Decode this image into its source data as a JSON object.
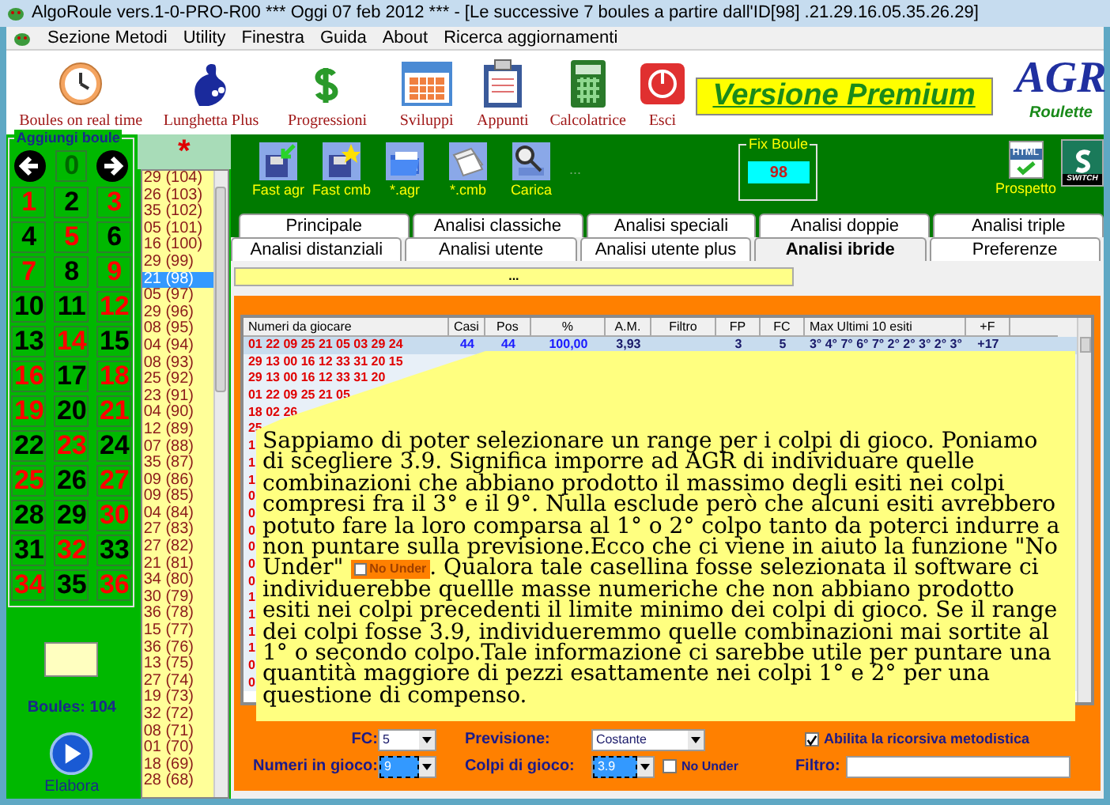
{
  "window": {
    "title": "AlgoRoule vers.1-0-PRO-R00  ***  Oggi 07 feb 2012  ***   - [Le successive 7 boules a partire dall'ID[98] .21.29.16.05.35.26.29]"
  },
  "menu": [
    "Sezione Metodi",
    "Utility",
    "Finestra",
    "Guida",
    "About",
    "Ricerca aggiornamenti"
  ],
  "toolbar": [
    {
      "label": "Boules on real time",
      "kind": "clock"
    },
    {
      "label": "Lunghetta Plus",
      "kind": "lottery"
    },
    {
      "label": "Progressioni",
      "kind": "dollar"
    },
    {
      "label": "Sviluppi",
      "kind": "calendar"
    },
    {
      "label": "Appunti",
      "kind": "clipboard"
    },
    {
      "label": "Calcolatrice",
      "kind": "calculator"
    },
    {
      "label": "Esci",
      "kind": "exit"
    }
  ],
  "banner": "Versione Premium",
  "logo": {
    "letters": "AGR",
    "caption": "Roulette"
  },
  "board": {
    "title": "Aggiungi boule",
    "zero": "0",
    "boules": "Boules: 104",
    "play_label": "Elabora",
    "numbers": [
      {
        "n": "1",
        "color": "#ff0000"
      },
      {
        "n": "2",
        "color": "#000000"
      },
      {
        "n": "3",
        "color": "#ff0000"
      },
      {
        "n": "4",
        "color": "#000000"
      },
      {
        "n": "5",
        "color": "#ff0000"
      },
      {
        "n": "6",
        "color": "#000000"
      },
      {
        "n": "7",
        "color": "#ff0000"
      },
      {
        "n": "8",
        "color": "#000000"
      },
      {
        "n": "9",
        "color": "#ff0000"
      },
      {
        "n": "10",
        "color": "#000000"
      },
      {
        "n": "11",
        "color": "#000000"
      },
      {
        "n": "12",
        "color": "#ff0000"
      },
      {
        "n": "13",
        "color": "#000000"
      },
      {
        "n": "14",
        "color": "#ff0000"
      },
      {
        "n": "15",
        "color": "#000000"
      },
      {
        "n": "16",
        "color": "#ff0000"
      },
      {
        "n": "17",
        "color": "#000000"
      },
      {
        "n": "18",
        "color": "#ff0000"
      },
      {
        "n": "19",
        "color": "#ff0000"
      },
      {
        "n": "20",
        "color": "#000000"
      },
      {
        "n": "21",
        "color": "#ff0000"
      },
      {
        "n": "22",
        "color": "#000000"
      },
      {
        "n": "23",
        "color": "#ff0000"
      },
      {
        "n": "24",
        "color": "#000000"
      },
      {
        "n": "25",
        "color": "#ff0000"
      },
      {
        "n": "26",
        "color": "#000000"
      },
      {
        "n": "27",
        "color": "#ff0000"
      },
      {
        "n": "28",
        "color": "#000000"
      },
      {
        "n": "29",
        "color": "#000000"
      },
      {
        "n": "30",
        "color": "#ff0000"
      },
      {
        "n": "31",
        "color": "#000000"
      },
      {
        "n": "32",
        "color": "#ff0000"
      },
      {
        "n": "33",
        "color": "#000000"
      },
      {
        "n": "34",
        "color": "#ff0000"
      },
      {
        "n": "35",
        "color": "#000000"
      },
      {
        "n": "36",
        "color": "#ff0000"
      }
    ]
  },
  "history": {
    "header": "*",
    "items": [
      {
        "text": "29 (104)",
        "selected": false
      },
      {
        "text": "26 (103)",
        "selected": false
      },
      {
        "text": "35 (102)",
        "selected": false
      },
      {
        "text": "05 (101)",
        "selected": false
      },
      {
        "text": "16 (100)",
        "selected": false
      },
      {
        "text": "29 (99)",
        "selected": false
      },
      {
        "text": "21 (98)",
        "selected": true
      },
      {
        "text": "05 (97)",
        "selected": false
      },
      {
        "text": "29 (96)",
        "selected": false
      },
      {
        "text": "08 (95)",
        "selected": false
      },
      {
        "text": "04 (94)",
        "selected": false
      },
      {
        "text": "08 (93)",
        "selected": false
      },
      {
        "text": "25 (92)",
        "selected": false
      },
      {
        "text": "23 (91)",
        "selected": false
      },
      {
        "text": "04 (90)",
        "selected": false
      },
      {
        "text": "12 (89)",
        "selected": false
      },
      {
        "text": "07 (88)",
        "selected": false
      },
      {
        "text": "35 (87)",
        "selected": false
      },
      {
        "text": "09 (86)",
        "selected": false
      },
      {
        "text": "09 (85)",
        "selected": false
      },
      {
        "text": "04 (84)",
        "selected": false
      },
      {
        "text": "27 (83)",
        "selected": false
      },
      {
        "text": "27 (82)",
        "selected": false
      },
      {
        "text": "21 (81)",
        "selected": false
      },
      {
        "text": "34 (80)",
        "selected": false
      },
      {
        "text": "30 (79)",
        "selected": false
      },
      {
        "text": "36 (78)",
        "selected": false
      },
      {
        "text": "15 (77)",
        "selected": false
      },
      {
        "text": "36 (76)",
        "selected": false
      },
      {
        "text": "13 (75)",
        "selected": false
      },
      {
        "text": "27 (74)",
        "selected": false
      },
      {
        "text": "19 (73)",
        "selected": false
      },
      {
        "text": "32 (72)",
        "selected": false
      },
      {
        "text": "08 (71)",
        "selected": false
      },
      {
        "text": "01 (70)",
        "selected": false
      },
      {
        "text": "18 (69)",
        "selected": false
      },
      {
        "text": "28 (68)",
        "selected": false
      }
    ]
  },
  "actions": [
    {
      "label": "Fast agr",
      "kind": "disk-in"
    },
    {
      "label": "Fast cmb",
      "kind": "disk-star"
    },
    {
      "label": "*.agr",
      "kind": "folder"
    },
    {
      "label": "*.cmb",
      "kind": "pages"
    },
    {
      "label": "Carica",
      "kind": "load"
    }
  ],
  "actions_more": "...",
  "fix_boule": {
    "title": "Fix Boule",
    "value": "98"
  },
  "prospetto": {
    "label": "Prospetto",
    "badge": "HTML"
  },
  "switch_label": "SWITCH",
  "tabs_row1": [
    {
      "label": "Principale",
      "selected": false
    },
    {
      "label": "Analisi classiche",
      "selected": false
    },
    {
      "label": "Analisi speciali",
      "selected": false
    },
    {
      "label": "Analisi doppie",
      "selected": false
    },
    {
      "label": "Analisi triple",
      "selected": false
    }
  ],
  "tabs_row2": [
    {
      "label": "Analisi distanziali",
      "selected": false
    },
    {
      "label": "Analisi utente",
      "selected": false
    },
    {
      "label": "Analisi utente plus",
      "selected": false
    },
    {
      "label": "Analisi ibride",
      "selected": true
    },
    {
      "label": "Preferenze",
      "selected": false
    }
  ],
  "info_bar": "...",
  "table": {
    "columns": [
      "Numeri da giocare",
      "Casi",
      "Pos",
      "%",
      "A.M.",
      "Filtro",
      "FP",
      "FC",
      "Max Ultimi 10 esiti",
      "+F"
    ],
    "rows": [
      {
        "selected": true,
        "cells": [
          "01 22 09 25 21 05 03 29 24",
          "44",
          "44",
          "100,00",
          "3,93",
          "",
          "3",
          "5",
          "3° 4° 7° 6° 7° 2° 2° 3° 2° 3°",
          "+17"
        ]
      },
      {
        "selected": false,
        "cells": [
          "29 13 00 16 12 33 31 20 15"
        ]
      },
      {
        "selected": false,
        "cells": [
          "29 13 00 16 12 33 31 20"
        ]
      },
      {
        "selected": false,
        "cells": [
          "01 22 09 25 21 05"
        ]
      },
      {
        "selected": false,
        "cells": [
          "18 02 26"
        ]
      },
      {
        "selected": false,
        "cells": [
          "25"
        ]
      },
      {
        "selected": false,
        "cells": [
          "1"
        ]
      },
      {
        "selected": false,
        "cells": [
          "1"
        ]
      },
      {
        "selected": false,
        "cells": [
          "1"
        ]
      },
      {
        "selected": false,
        "cells": [
          "0"
        ]
      },
      {
        "selected": false,
        "cells": [
          "0"
        ]
      },
      {
        "selected": false,
        "cells": [
          "0"
        ]
      },
      {
        "selected": false,
        "cells": [
          "0"
        ]
      },
      {
        "selected": false,
        "cells": [
          "0"
        ]
      },
      {
        "selected": false,
        "cells": [
          "0"
        ]
      },
      {
        "selected": false,
        "cells": [
          "1"
        ]
      },
      {
        "selected": false,
        "cells": [
          "1"
        ]
      },
      {
        "selected": false,
        "cells": [
          "1"
        ]
      },
      {
        "selected": false,
        "cells": [
          "1"
        ]
      },
      {
        "selected": false,
        "cells": [
          "0"
        ]
      },
      {
        "selected": false,
        "cells": [
          "0"
        ]
      }
    ]
  },
  "callout": {
    "text_before": "Sappiamo di poter selezionare un range per i colpi di gioco. Poniamo di scegliere 3.9. Significa imporre ad AGR di individuare quelle combinazioni che abbiano prodotto il massimo degli esiti nei colpi compresi fra il 3° e il 9°. Nulla esclude però che alcuni esiti avrebbero potuto fare la loro comparsa al 1° o 2° colpo tanto da poterci indurre a non puntare sulla previsione.Ecco che ci viene in aiuto la funzione \"No Under\"",
    "inline_label": "No Under",
    "inline_checked": false,
    "text_after": ". Qualora tale casellina fosse selezionata il software ci individuerebbe quellle masse numeriche che non abbiano prodotto esiti nei colpi precedenti il limite minimo dei colpi di gioco. Se il range dei colpi fosse 3.9, individueremmo quelle combinazioni mai sortite al 1° o secondo colpo.Tale informazione ci sarebbe utile per puntare una quantità maggiore di pezzi esattamente nei colpi 1° e 2° per una questione di compenso."
  },
  "controls": {
    "fc": {
      "label": "FC:",
      "value": "5",
      "selected": false
    },
    "previsione": {
      "label": "Previsione:",
      "value": "Costante",
      "selected": false
    },
    "ricorsiva": {
      "label": "Abilita la ricorsiva metodistica",
      "checked": true
    },
    "numeri": {
      "label": "Numeri in gioco:",
      "value": "9",
      "selected": true
    },
    "colpi": {
      "label": "Colpi di gioco:",
      "value": "3.9",
      "selected": true
    },
    "no_under": {
      "label": "No Under",
      "checked": false
    },
    "filtro": {
      "label": "Filtro:"
    }
  }
}
